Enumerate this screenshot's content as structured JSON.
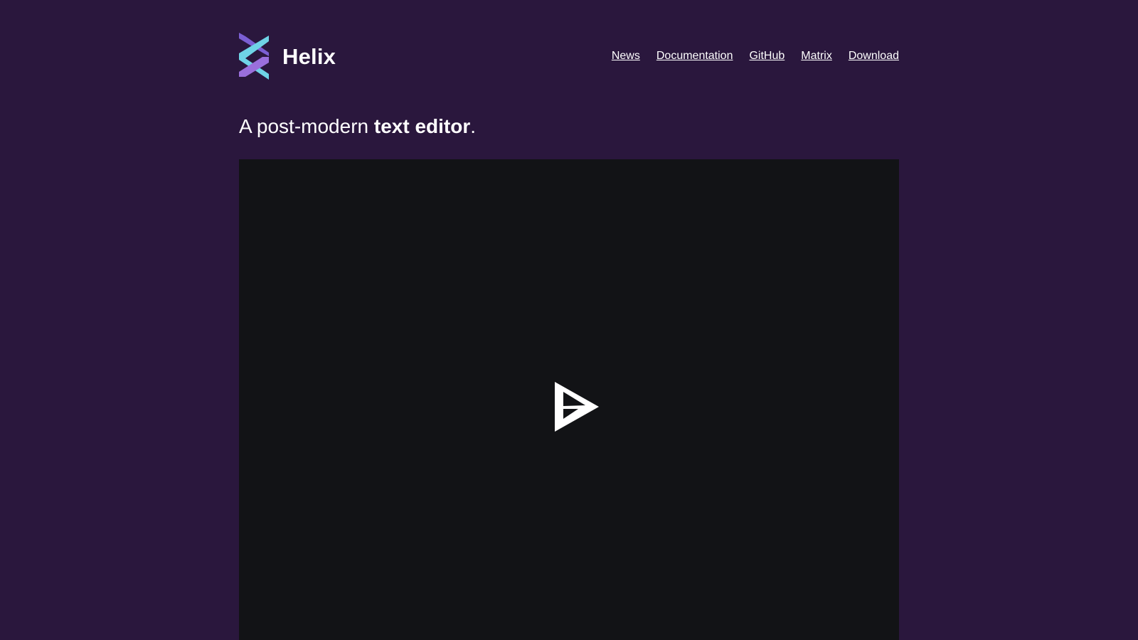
{
  "brand": {
    "name": "Helix",
    "logo_icon": "helix-logo-icon",
    "colors": {
      "purple": "#7b5fd3",
      "cyan": "#6fd3e6"
    }
  },
  "nav": [
    {
      "label": "News"
    },
    {
      "label": "Documentation"
    },
    {
      "label": "GitHub"
    },
    {
      "label": "Matrix"
    },
    {
      "label": "Download"
    }
  ],
  "hero": {
    "tagline_prefix": "A post-modern ",
    "tagline_emphasis": "text editor",
    "tagline_suffix": "."
  },
  "player": {
    "play_icon": "asciinema-play-icon",
    "background": "#121316"
  },
  "page": {
    "background": "#2a173d"
  }
}
